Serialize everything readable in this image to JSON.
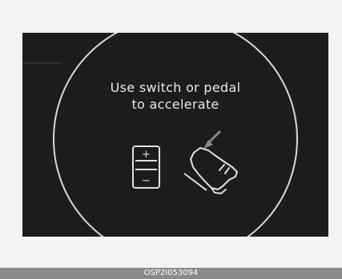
{
  "display": {
    "message_line1": "Use switch or pedal",
    "message_line2": "to accelerate",
    "switch_plus": "+",
    "switch_minus": "−",
    "icons": [
      "switch-icon",
      "arrow-icon",
      "pedal-icon",
      "foot-icon"
    ]
  },
  "caption": {
    "code": "OSP2I053094"
  },
  "colors": {
    "screen_background": "#1c1c1c",
    "foreground": "#e9e9e9",
    "caption_bar": "#8a8a8a"
  }
}
